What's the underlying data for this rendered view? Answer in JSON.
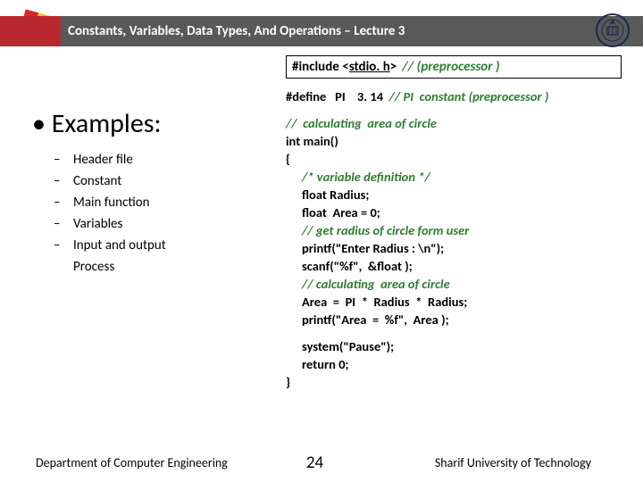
{
  "header": {
    "title": "Constants, Variables, Data Types, And Operations – Lecture 3"
  },
  "includeBox": {
    "part1": "#include <",
    "underlined": "stdio. h",
    "part2": "> ",
    "comment": "// (preprocessor )"
  },
  "examples": {
    "heading": "Examples:",
    "items": [
      {
        "label": "Header file",
        "dash": true
      },
      {
        "label": "Constant",
        "dash": true
      },
      {
        "label": "Main function",
        "dash": true
      },
      {
        "label": "Variables",
        "dash": true
      },
      {
        "label": "Input and output",
        "dash": true
      },
      {
        "label": "Process",
        "dash": false
      }
    ]
  },
  "code": {
    "l1a": "#define   PI    3. 14  ",
    "l1b": "// PI  constant (preprocessor )",
    "l2": "//  calculating  area of circle",
    "l3": "int main()",
    "l4": "{",
    "l5": "/* variable definition */",
    "l6": "float Radius;",
    "l7": "float  Area = 0;",
    "l8": "// get radius of circle form user",
    "l9": "printf(\"Enter Radius : \\n\");",
    "l10": "scanf(\"%f\",  &float );",
    "l11": "// calculating  area of circle",
    "l12": "Area  =  PI  *  Radius  *  Radius;",
    "l13": "printf(\"Area  =  %f\",  Area );",
    "l14": "system(\"Pause\");",
    "l15": "return 0;",
    "l16": "}"
  },
  "footer": {
    "dept": "Department of Computer Engineering",
    "page": "24",
    "uni": "Sharif University of Technology"
  }
}
